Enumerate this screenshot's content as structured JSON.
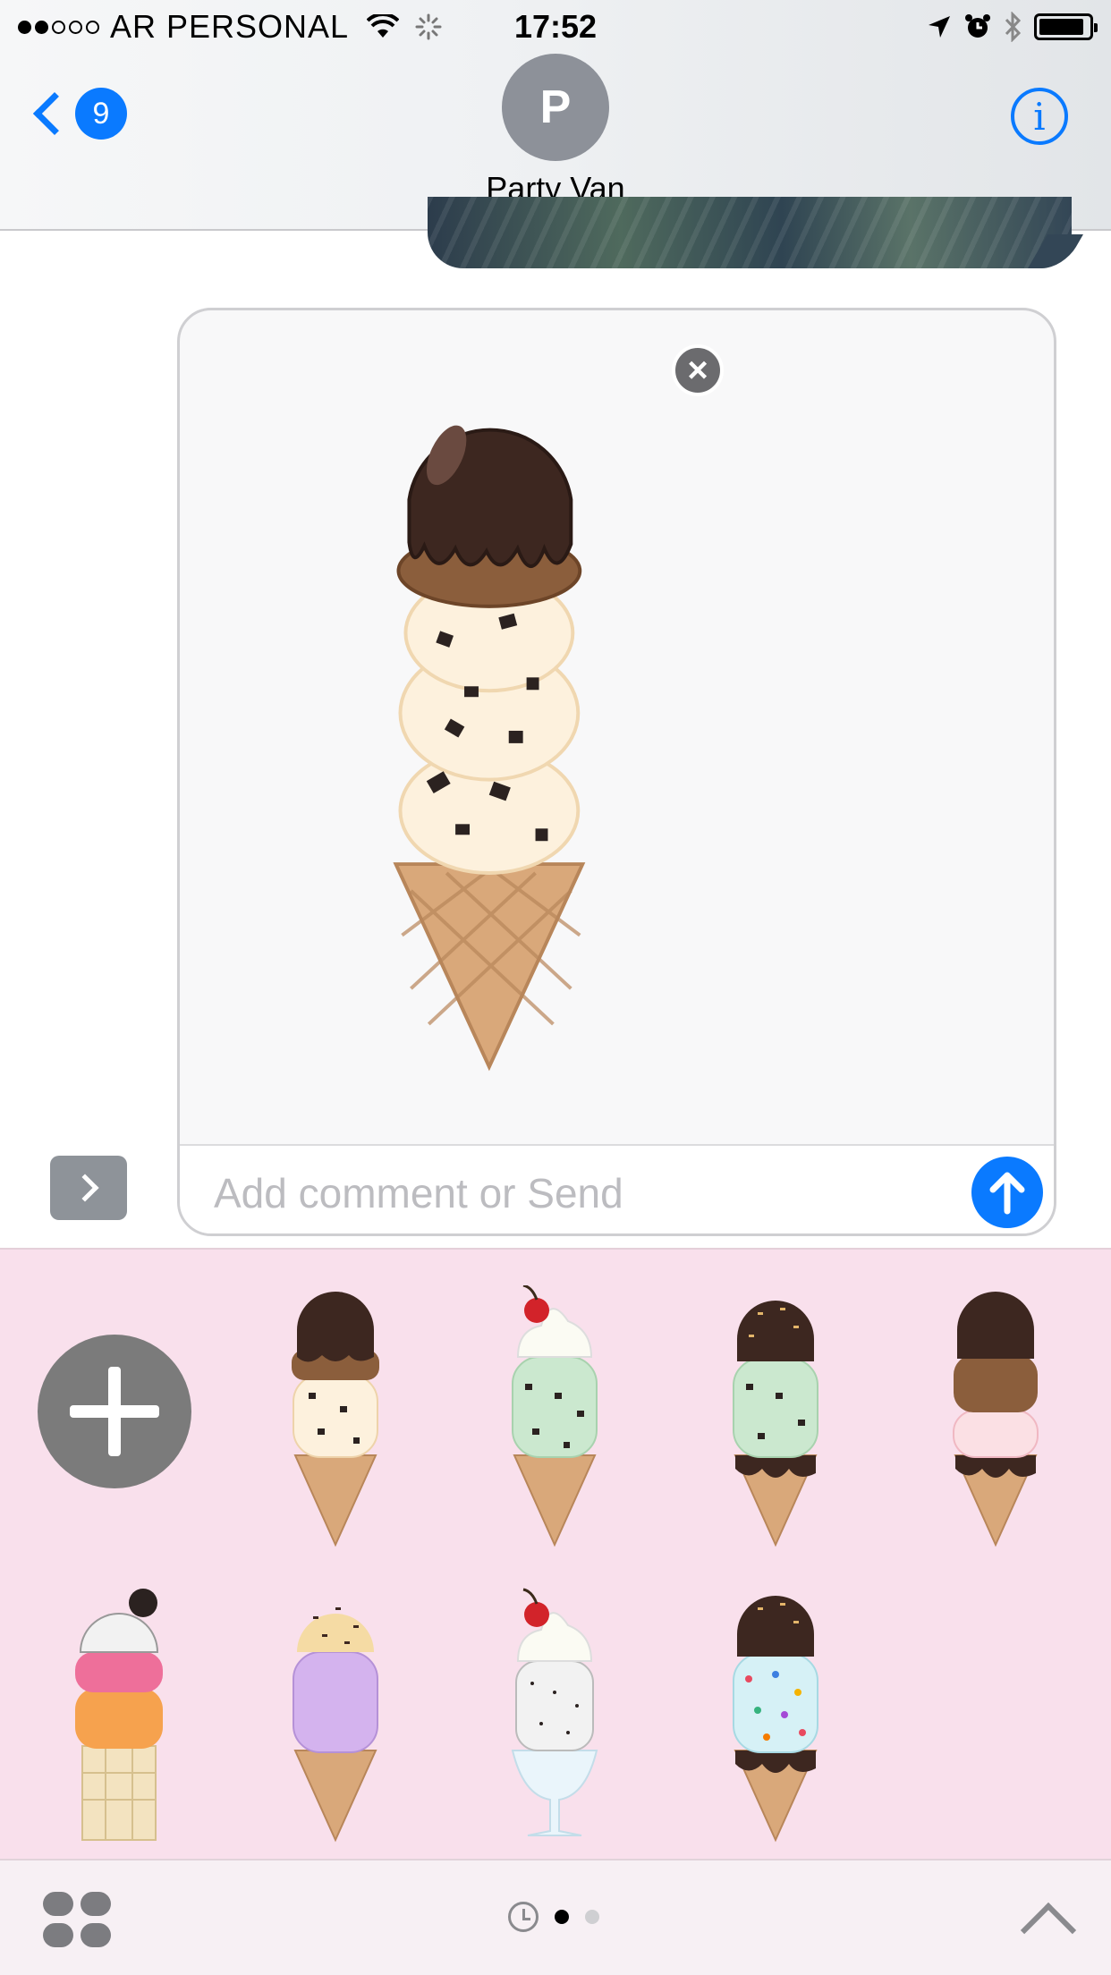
{
  "status_bar": {
    "signal_dots_filled": 2,
    "signal_dots_total": 5,
    "carrier": "AR PERSONAL",
    "time": "17:52",
    "battery_level": 0.9
  },
  "nav": {
    "back_badge": "9",
    "contact_initial": "P",
    "contact_name": "Party Van",
    "info_label": "i"
  },
  "compose": {
    "placeholder": "Add comment or Send",
    "remove_label": "×"
  },
  "drawer": {
    "stickers": [
      {
        "name": "chocolate-chip-cone",
        "row": 1
      },
      {
        "name": "mint-cherry-cone",
        "row": 1
      },
      {
        "name": "mint-sprinkle-cone",
        "row": 1
      },
      {
        "name": "strawberry-chocolate-cone",
        "row": 1
      },
      {
        "name": "cookies-cream-cake-cone",
        "row": 2
      },
      {
        "name": "grape-sprinkle-cone",
        "row": 2
      },
      {
        "name": "cookies-cream-sundae",
        "row": 2
      },
      {
        "name": "confetti-dip-cone",
        "row": 2
      }
    ]
  },
  "toolbar": {
    "pages": 2,
    "active_page": 1
  },
  "colors": {
    "accent": "#0a7aff",
    "drawer_bg": "#f9e0ec"
  }
}
